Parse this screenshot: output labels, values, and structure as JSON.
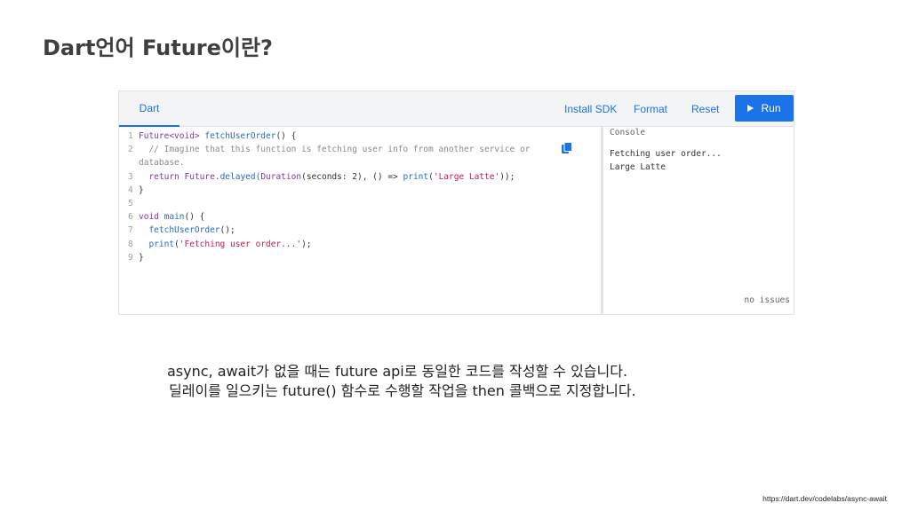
{
  "slide": {
    "title": "Dart언어 Future이란?",
    "caption_line_1": "async, await가 없을 때는 future api로 동일한 코드를 작성할 수 있습니다.",
    "caption_line_2": "딜레이를 일으키는 future() 함수로 수행할 작업을 then 콜백으로 지정합니다.",
    "source_url": "https://dart.dev/codelabs/async-await"
  },
  "dartpad": {
    "tab_label": "Dart",
    "install_sdk_label": "Install SDK",
    "format_label": "Format",
    "reset_label": "Reset",
    "run_label": "Run",
    "icons": {
      "run": "play-icon",
      "copy": "copy-icon"
    },
    "accent_color": "#1a73e8",
    "code": {
      "line_numbers": [
        "1",
        "2",
        "",
        "3",
        "4",
        "5",
        "6",
        "7",
        "8",
        "9"
      ],
      "l1_type": "Future<void>",
      "l1_name": "fetchUserOrder",
      "l1_rest": "() {",
      "l2_comment": "// Imagine that this function is fetching user info from another service or",
      "l2b_comment": "database.",
      "l3_return": "return",
      "l3_future": "Future",
      "l3_delayed": ".delayed(",
      "l3_duration": "Duration",
      "l3_args": "(seconds: 2), () =>",
      "l3_print": "print",
      "l3_paren": "(",
      "l3_string": "'Large Latte'",
      "l3_end": "));",
      "l4": "}",
      "l5": "",
      "l6_void": "void",
      "l6_main": "main",
      "l6_rest": "() {",
      "l7_call": "fetchUserOrder",
      "l7_rest": "();",
      "l8_print": "print",
      "l8_paren": "(",
      "l8_string": "'Fetching user order...'",
      "l8_end": ");",
      "l9": "}"
    },
    "console": {
      "label": "Console",
      "lines": [
        "Fetching user order...",
        "Large Latte"
      ],
      "status": "no issues"
    }
  }
}
